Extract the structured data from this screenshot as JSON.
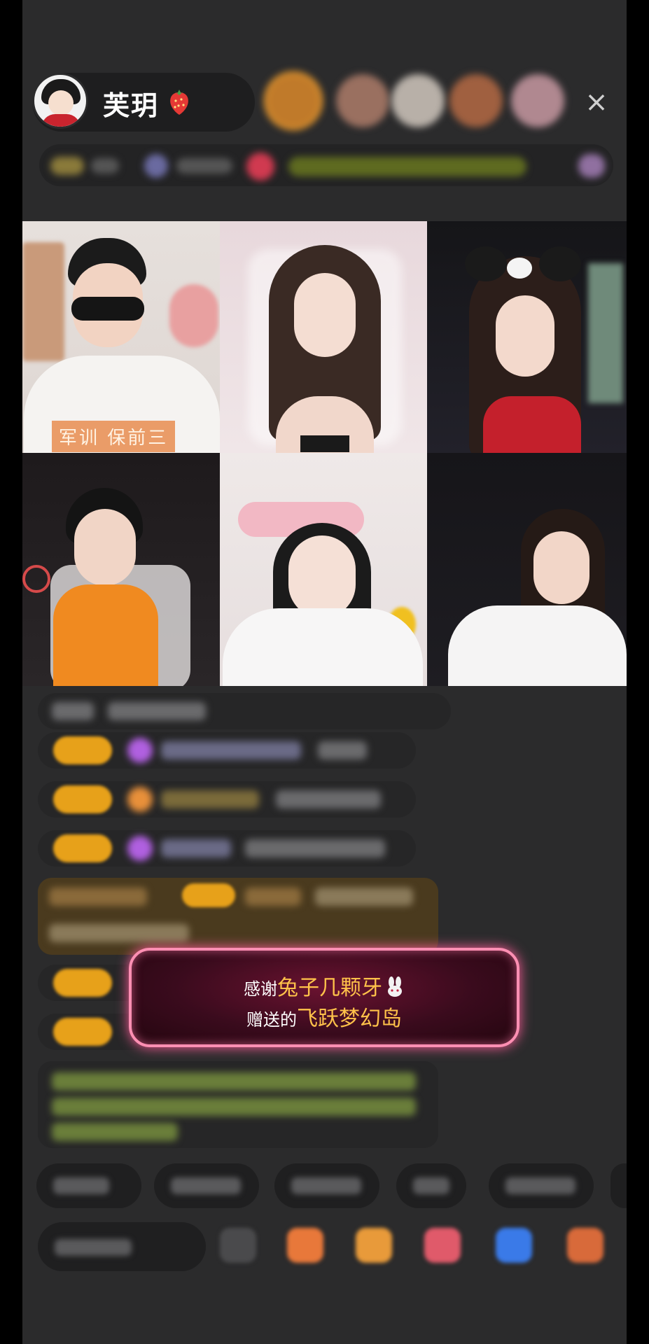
{
  "host": {
    "name": "芙玥",
    "name_icon": "strawberry-icon",
    "avatar_icon": "avatar"
  },
  "header": {
    "close_icon": "close-icon",
    "close_glyph": "×"
  },
  "video_grid": {
    "tile_1_tag": "军训 保前三"
  },
  "gift_banner": {
    "line1_prefix": "感谢",
    "sender": "兔子几颗牙",
    "sender_icon": "rabbit-icon",
    "line2_prefix": "赠送的",
    "gift_name": "飞跃梦幻岛"
  },
  "colors": {
    "screen_bg": "#2b2b2c",
    "badge": "#e7a11a",
    "gift_highlight": "#ffc24a",
    "banner_border": "#ff8fb3"
  }
}
